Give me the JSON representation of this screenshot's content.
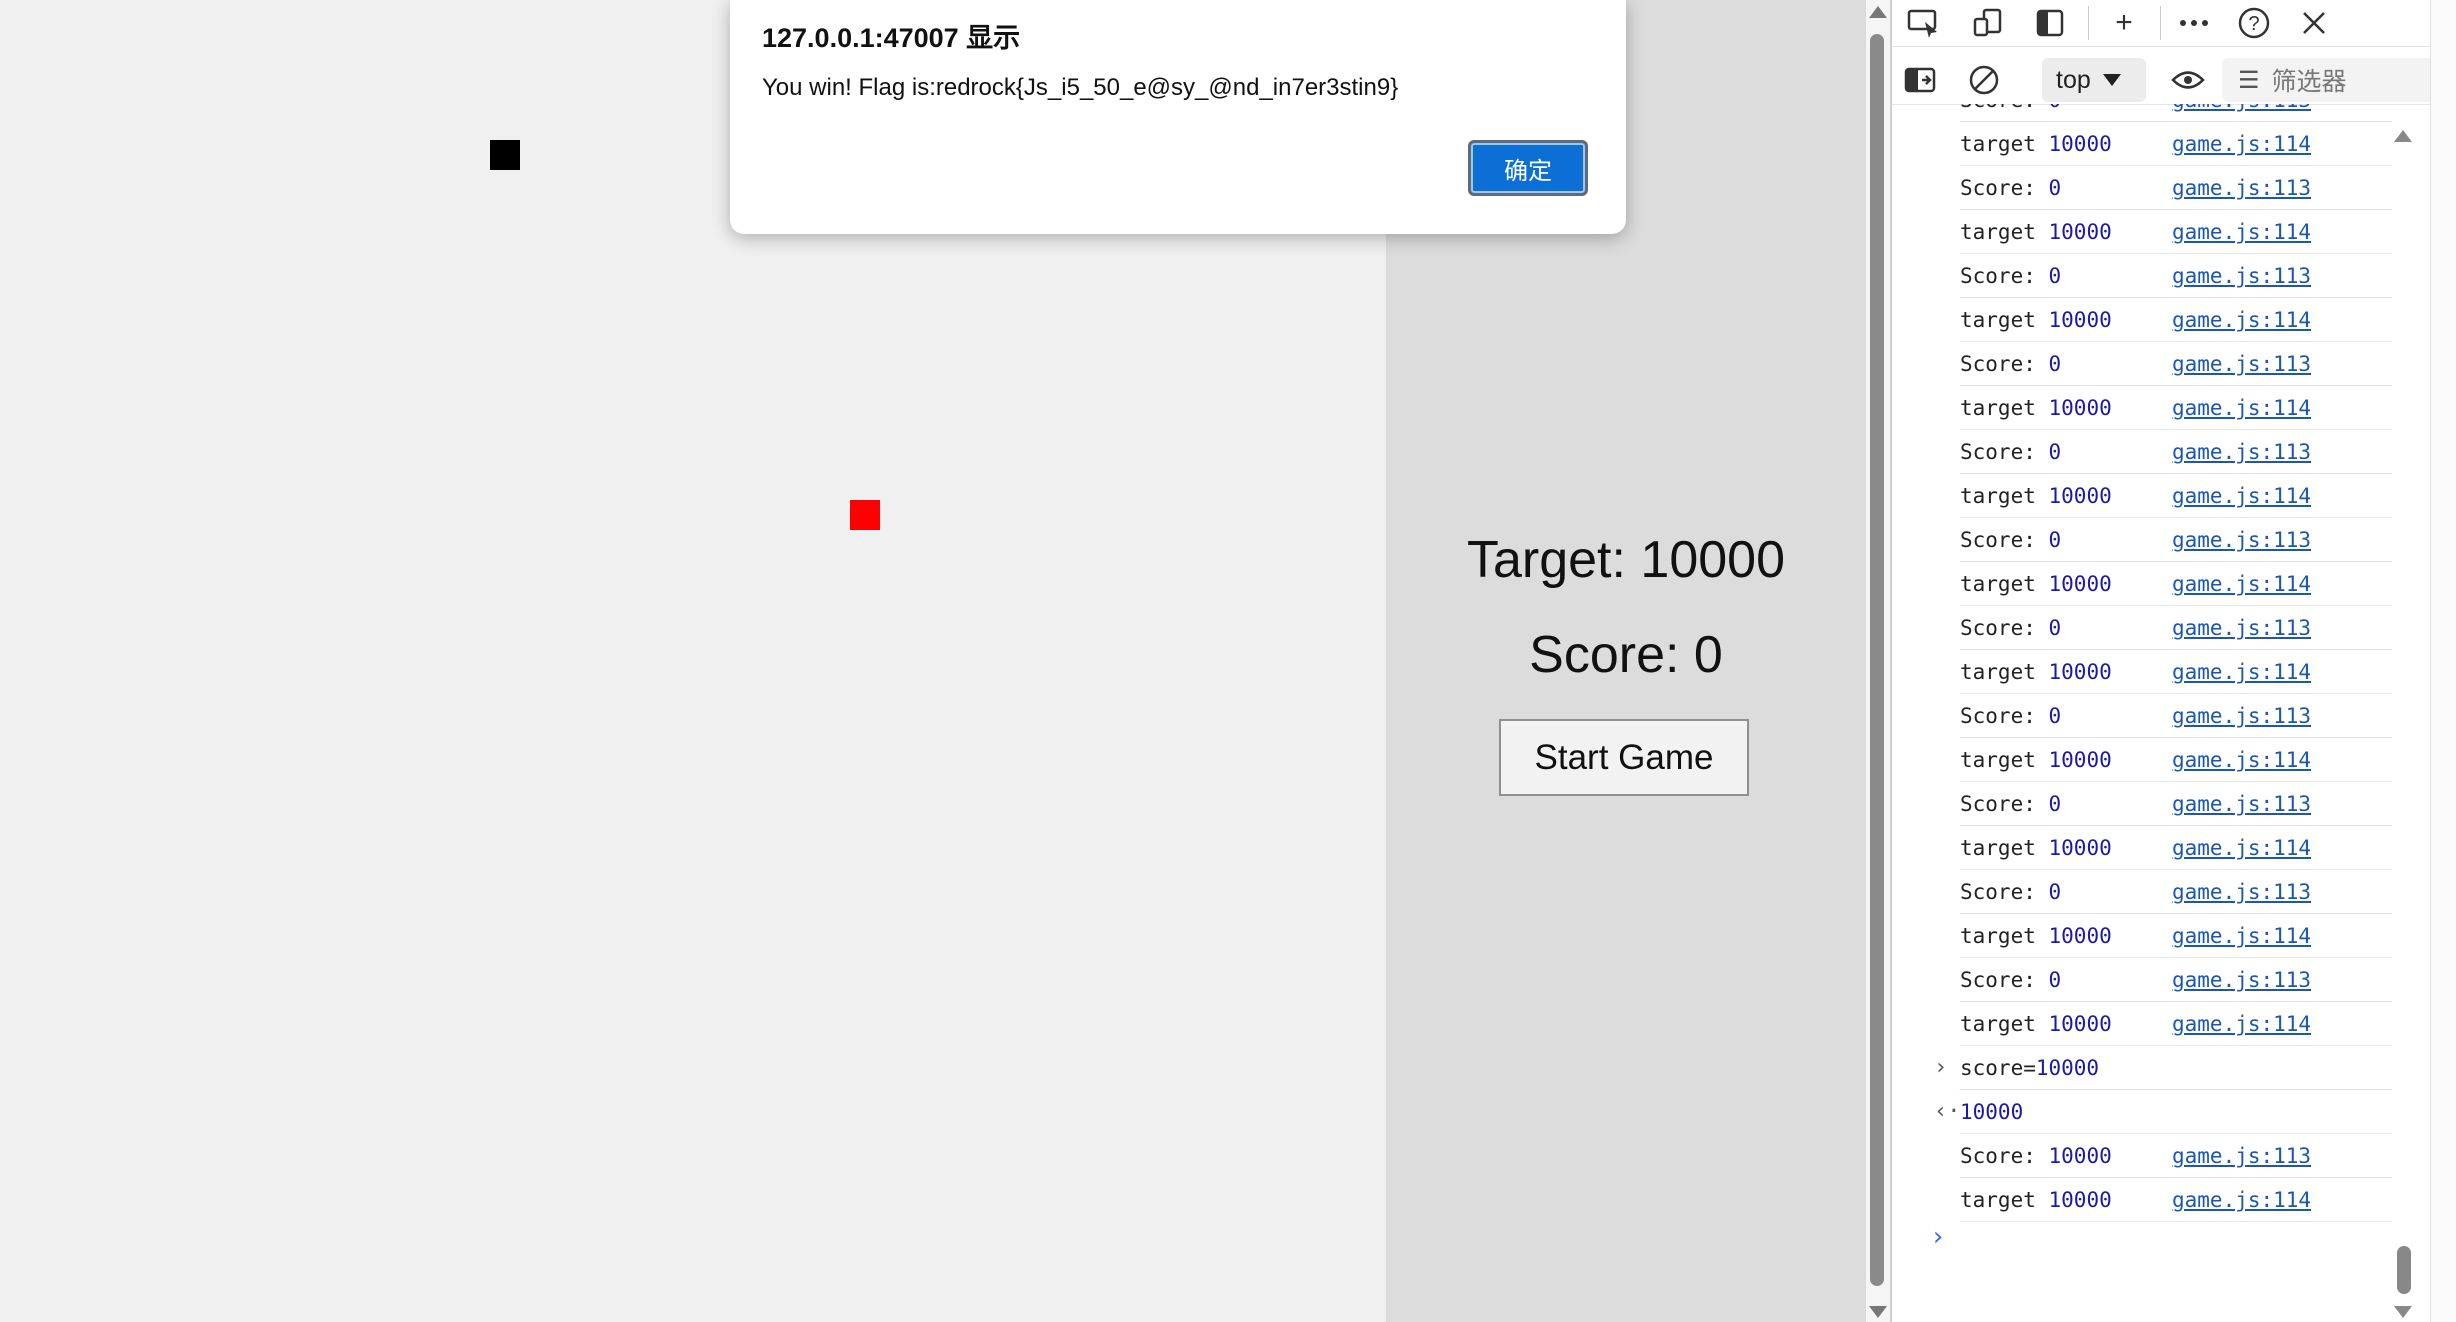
{
  "game": {
    "snake_color": "#000000",
    "food_color": "#ff0000",
    "target_text": "Target: 10000",
    "score_text": "Score: 0",
    "start_button": "Start Game"
  },
  "alert": {
    "title": "127.0.0.1:47007 显示",
    "message": "You win! Flag is:redrock{Js_i5_50_e@sy_@nd_in7er3stin9}",
    "ok_label": "确定"
  },
  "devtools": {
    "toolbar_icons": [
      "inspect-icon",
      "device-icon",
      "dock-icon",
      "plus-icon",
      "more-icon",
      "help-icon",
      "close-icon"
    ],
    "context": "top",
    "filter_placeholder": "筛选器",
    "partial_top_row": {
      "label": "Score: ",
      "value": "0",
      "source": "game.js:113"
    },
    "logs": [
      {
        "label": "target",
        "value": "10000",
        "source": "game.js:114"
      },
      {
        "label": "Score: ",
        "value": "0",
        "source": "game.js:113"
      },
      {
        "label": "target",
        "value": "10000",
        "source": "game.js:114"
      },
      {
        "label": "Score: ",
        "value": "0",
        "source": "game.js:113"
      },
      {
        "label": "target",
        "value": "10000",
        "source": "game.js:114"
      },
      {
        "label": "Score: ",
        "value": "0",
        "source": "game.js:113"
      },
      {
        "label": "target",
        "value": "10000",
        "source": "game.js:114"
      },
      {
        "label": "Score: ",
        "value": "0",
        "source": "game.js:113"
      },
      {
        "label": "target",
        "value": "10000",
        "source": "game.js:114"
      },
      {
        "label": "Score: ",
        "value": "0",
        "source": "game.js:113"
      },
      {
        "label": "target",
        "value": "10000",
        "source": "game.js:114"
      },
      {
        "label": "Score: ",
        "value": "0",
        "source": "game.js:113"
      },
      {
        "label": "target",
        "value": "10000",
        "source": "game.js:114"
      },
      {
        "label": "Score: ",
        "value": "0",
        "source": "game.js:113"
      },
      {
        "label": "target",
        "value": "10000",
        "source": "game.js:114"
      },
      {
        "label": "Score: ",
        "value": "0",
        "source": "game.js:113"
      },
      {
        "label": "target",
        "value": "10000",
        "source": "game.js:114"
      },
      {
        "label": "Score: ",
        "value": "0",
        "source": "game.js:113"
      },
      {
        "label": "target",
        "value": "10000",
        "source": "game.js:114"
      },
      {
        "label": "Score: ",
        "value": "0",
        "source": "game.js:113"
      },
      {
        "label": "target",
        "value": "10000",
        "source": "game.js:114"
      }
    ],
    "command": {
      "text": "score=",
      "value": "10000"
    },
    "result": "10000",
    "after_logs": [
      {
        "label": "Score: ",
        "value": "10000",
        "source": "game.js:113"
      },
      {
        "label": "target",
        "value": "10000",
        "source": "game.js:114"
      }
    ]
  }
}
